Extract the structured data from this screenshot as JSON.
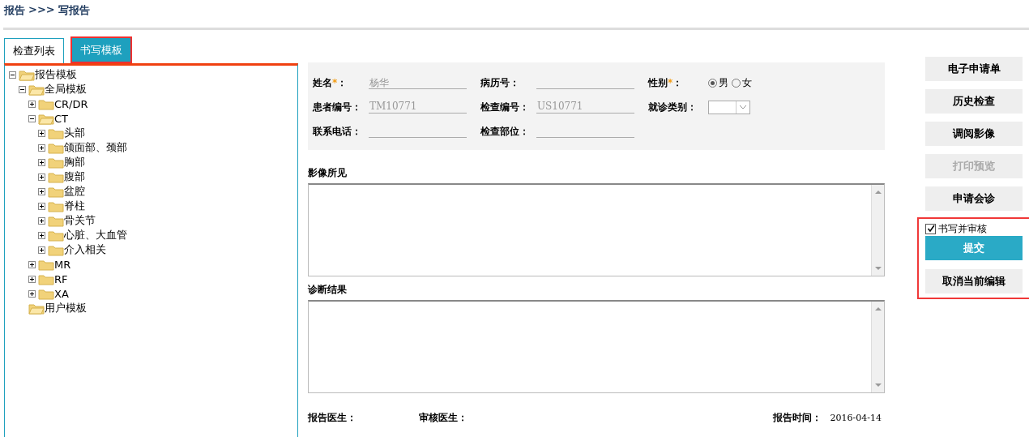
{
  "breadcrumb": {
    "parent": "报告",
    "separator": ">>>",
    "current": "写报告"
  },
  "tabs": [
    {
      "label": "检查列表",
      "selected": false
    },
    {
      "label": "书写模板",
      "selected": true
    }
  ],
  "tree": [
    {
      "label": "报告模板",
      "kind": "branch",
      "expanded": true,
      "children": [
        {
          "label": "全局模板",
          "kind": "branch",
          "expanded": true,
          "children": [
            {
              "label": "CR/DR",
              "kind": "branch",
              "expanded": false
            },
            {
              "label": "CT",
              "kind": "branch",
              "expanded": true,
              "children": [
                {
                  "label": "头部",
                  "kind": "branch",
                  "expanded": false
                },
                {
                  "label": "颌面部、颈部",
                  "kind": "branch",
                  "expanded": false
                },
                {
                  "label": "胸部",
                  "kind": "branch",
                  "expanded": false
                },
                {
                  "label": "腹部",
                  "kind": "branch",
                  "expanded": false
                },
                {
                  "label": "盆腔",
                  "kind": "branch",
                  "expanded": false
                },
                {
                  "label": "脊柱",
                  "kind": "branch",
                  "expanded": false
                },
                {
                  "label": "骨关节",
                  "kind": "branch",
                  "expanded": false
                },
                {
                  "label": "心脏、大血管",
                  "kind": "branch",
                  "expanded": false
                },
                {
                  "label": "介入相关",
                  "kind": "branch",
                  "expanded": false
                }
              ]
            },
            {
              "label": "MR",
              "kind": "branch",
              "expanded": false
            },
            {
              "label": "RF",
              "kind": "branch",
              "expanded": false
            },
            {
              "label": "XA",
              "kind": "branch",
              "expanded": false
            }
          ]
        },
        {
          "label": "用户模板",
          "kind": "leaf"
        }
      ]
    }
  ],
  "form": {
    "rows": [
      [
        {
          "label": "姓名",
          "required_mark": "*",
          "colon": "：",
          "kind": "text",
          "value": "杨华"
        },
        {
          "label": "病历号",
          "colon": "：",
          "kind": "text"
        },
        {
          "label": "性别",
          "required_mark": "*",
          "colon": "：",
          "kind": "radio",
          "options": [
            {
              "label": "男",
              "selected": true
            },
            {
              "label": "女",
              "selected": false
            }
          ]
        }
      ],
      [
        {
          "label": "患者编号",
          "colon": "：",
          "kind": "text",
          "value": "TM10771"
        },
        {
          "label": "检查编号",
          "colon": "：",
          "kind": "text",
          "value": "US10771"
        },
        {
          "label": "就诊类别",
          "colon": "：",
          "kind": "select"
        }
      ],
      [
        {
          "label": "联系电话",
          "colon": "：",
          "kind": "text"
        },
        {
          "label": "检查部位",
          "colon": "：",
          "kind": "text"
        }
      ]
    ]
  },
  "sections": [
    {
      "label": "影像所见"
    },
    {
      "label": "诊断结果"
    }
  ],
  "footer": {
    "report_doctor": "报告医生：",
    "review_doctor": "审核医生：",
    "report_time_label": "报告时间：",
    "report_time": "2016-04-14"
  },
  "buttons": [
    {
      "label": "电子申请单",
      "disabled": false
    },
    {
      "label": "历史检查",
      "disabled": false
    },
    {
      "label": "调阅影像",
      "disabled": false
    },
    {
      "label": "打印预览",
      "disabled": true
    },
    {
      "label": "申请会诊",
      "disabled": false
    }
  ],
  "submit_group": {
    "checkbox": {
      "label": "书写并审核",
      "checked": true
    },
    "submit": "提交",
    "cancel": "取消当前编辑"
  }
}
